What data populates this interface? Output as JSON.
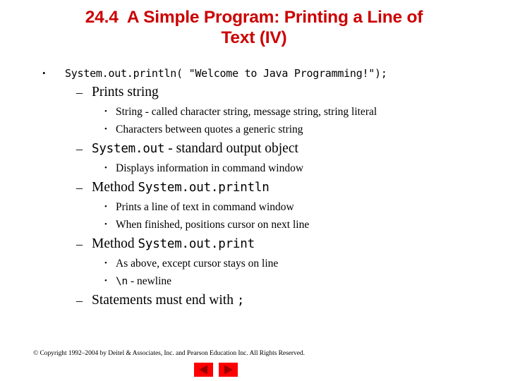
{
  "slide": {
    "title": "24.4  A Simple Program: Printing a Line of\nText (IV)",
    "title_color": "#CC0000",
    "background_color": "#FFFFFF",
    "outline": [
      {
        "level": 1,
        "bullet": "•",
        "style": "mono",
        "text": "System.out.println( \"Welcome to Java Programming!\");"
      },
      {
        "level": 2,
        "bullet": "–",
        "style": "serif",
        "text": "Prints string"
      },
      {
        "level": 3,
        "bullet": "•",
        "style": "serif",
        "text": "String - called character string, message string, string literal"
      },
      {
        "level": 3,
        "bullet": "•",
        "style": "serif",
        "text": "Characters between quotes a generic string"
      },
      {
        "level": 2,
        "bullet": "–",
        "style": "mixed",
        "mono_lead": "System.out",
        "text": " - standard output object"
      },
      {
        "level": 3,
        "bullet": "•",
        "style": "serif",
        "text": "Displays information in command window"
      },
      {
        "level": 2,
        "bullet": "–",
        "style": "mixed-trail",
        "text": "Method ",
        "mono_trail": "System.out.println"
      },
      {
        "level": 3,
        "bullet": "•",
        "style": "serif",
        "text": "Prints a line of text in command window"
      },
      {
        "level": 3,
        "bullet": "•",
        "style": "serif",
        "text": "When finished, positions cursor on next line"
      },
      {
        "level": 2,
        "bullet": "–",
        "style": "mixed-trail",
        "text": "Method ",
        "mono_trail": "System.out.print"
      },
      {
        "level": 3,
        "bullet": "•",
        "style": "serif",
        "text": "As above, except cursor stays on line"
      },
      {
        "level": 3,
        "bullet": "•",
        "style": "mixed",
        "mono_lead": "\\n",
        "text": "  - newline"
      },
      {
        "level": 2,
        "bullet": "–",
        "style": "mixed-trail",
        "text": "Statements must end with ",
        "mono_trail": ";"
      }
    ]
  },
  "footer": {
    "copyright": "© Copyright 1992–2004 by Deitel & Associates, Inc. and Pearson Education Inc. All Rights Reserved."
  },
  "nav": {
    "prev_label": "Previous slide",
    "next_label": "Next slide",
    "button_color": "#FF0000",
    "arrow_color": "#990000"
  }
}
